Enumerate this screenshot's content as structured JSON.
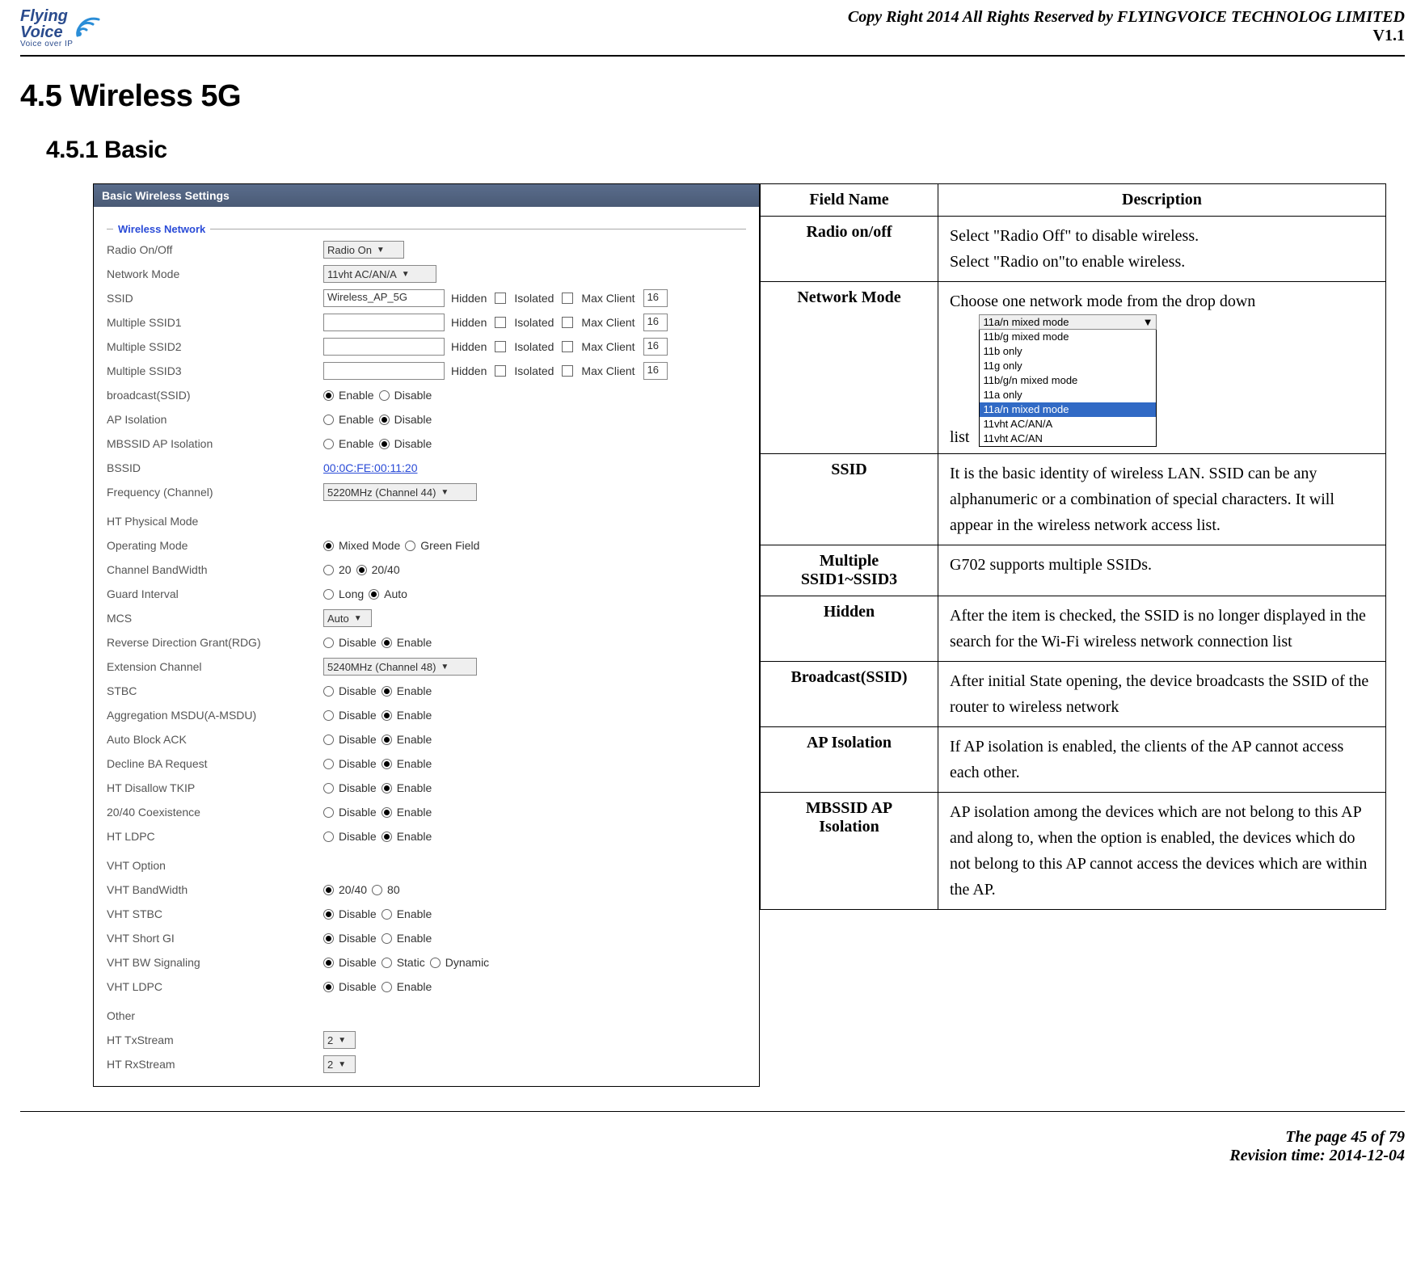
{
  "header": {
    "logo_line1": "Flying",
    "logo_line2": "Voice",
    "logo_sub": "Voice over IP",
    "copyright": "Copy Right 2014 All Rights Reserved by FLYINGVOICE TECHNOLOG LIMITED",
    "version": "V1.1"
  },
  "section": {
    "num_title": "4.5  Wireless 5G",
    "sub_num_title": "4.5.1 Basic"
  },
  "ui": {
    "title_bar": "Basic Wireless Settings",
    "fieldset": "Wireless Network",
    "rows": {
      "radio_onoff": {
        "label": "Radio On/Off",
        "value": "Radio On"
      },
      "network_mode": {
        "label": "Network Mode",
        "value": "11vht AC/AN/A"
      },
      "ssid": {
        "label": "SSID",
        "value": "Wireless_AP_5G",
        "hidden": "Hidden",
        "isolated": "Isolated",
        "max_client_label": "Max Client",
        "max_client_value": "16"
      },
      "mssid1": {
        "label": "Multiple SSID1",
        "hidden": "Hidden",
        "isolated": "Isolated",
        "max_client_label": "Max Client",
        "max_client_value": "16"
      },
      "mssid2": {
        "label": "Multiple SSID2",
        "hidden": "Hidden",
        "isolated": "Isolated",
        "max_client_label": "Max Client",
        "max_client_value": "16"
      },
      "mssid3": {
        "label": "Multiple SSID3",
        "hidden": "Hidden",
        "isolated": "Isolated",
        "max_client_label": "Max Client",
        "max_client_value": "16"
      },
      "broadcast": {
        "label": "broadcast(SSID)",
        "opt1": "Enable",
        "opt2": "Disable",
        "sel": "Enable"
      },
      "ap_iso": {
        "label": "AP Isolation",
        "opt1": "Enable",
        "opt2": "Disable",
        "sel": "Disable"
      },
      "mbssid_iso": {
        "label": "MBSSID AP Isolation",
        "opt1": "Enable",
        "opt2": "Disable",
        "sel": "Disable"
      },
      "bssid": {
        "label": "BSSID",
        "value": "00:0C:FE:00:11:20"
      },
      "freq": {
        "label": "Frequency (Channel)",
        "value": "5220MHz (Channel 44)"
      },
      "ht_header": "HT Physical Mode",
      "op_mode": {
        "label": "Operating Mode",
        "opt1": "Mixed Mode",
        "opt2": "Green Field",
        "sel": "Mixed Mode"
      },
      "ch_bw": {
        "label": "Channel BandWidth",
        "opt1": "20",
        "opt2": "20/40",
        "sel": "20/40"
      },
      "guard": {
        "label": "Guard Interval",
        "opt1": "Long",
        "opt2": "Auto",
        "sel": "Auto"
      },
      "mcs": {
        "label": "MCS",
        "value": "Auto"
      },
      "rdg": {
        "label": "Reverse Direction Grant(RDG)",
        "opt1": "Disable",
        "opt2": "Enable",
        "sel": "Enable"
      },
      "ext_ch": {
        "label": "Extension Channel",
        "value": "5240MHz (Channel 48)"
      },
      "stbc": {
        "label": "STBC",
        "opt1": "Disable",
        "opt2": "Enable",
        "sel": "Enable"
      },
      "amsdu": {
        "label": "Aggregation MSDU(A-MSDU)",
        "opt1": "Disable",
        "opt2": "Enable",
        "sel": "Enable"
      },
      "abck": {
        "label": "Auto Block ACK",
        "opt1": "Disable",
        "opt2": "Enable",
        "sel": "Enable"
      },
      "dba": {
        "label": "Decline BA Request",
        "opt1": "Disable",
        "opt2": "Enable",
        "sel": "Enable"
      },
      "tkip": {
        "label": "HT Disallow TKIP",
        "opt1": "Disable",
        "opt2": "Enable",
        "sel": "Enable"
      },
      "coex": {
        "label": "20/40 Coexistence",
        "opt1": "Disable",
        "opt2": "Enable",
        "sel": "Enable"
      },
      "ldpc": {
        "label": "HT LDPC",
        "opt1": "Disable",
        "opt2": "Enable",
        "sel": "Enable"
      },
      "vht_header": "VHT Option",
      "vht_bw": {
        "label": "VHT BandWidth",
        "opt1": "20/40",
        "opt2": "80",
        "sel": "20/40"
      },
      "vht_stbc": {
        "label": "VHT STBC",
        "opt1": "Disable",
        "opt2": "Enable",
        "sel": "Disable"
      },
      "vht_sgi": {
        "label": "VHT Short GI",
        "opt1": "Disable",
        "opt2": "Enable",
        "sel": "Disable"
      },
      "vht_bws": {
        "label": "VHT BW Signaling",
        "opt1": "Disable",
        "opt2": "Static",
        "opt3": "Dynamic",
        "sel": "Disable"
      },
      "vht_ldpc": {
        "label": "VHT LDPC",
        "opt1": "Disable",
        "opt2": "Enable",
        "sel": "Disable"
      },
      "other_header": "Other",
      "httx": {
        "label": "HT TxStream",
        "value": "2"
      },
      "htrx": {
        "label": "HT RxStream",
        "value": "2"
      }
    }
  },
  "desc_table": {
    "h1": "Field Name",
    "h2": "Description",
    "rows": [
      {
        "name": "Radio on/off",
        "desc_lines": [
          "Select \"Radio Off\" to disable wireless.",
          "Select \"Radio on\"to enable wireless."
        ]
      },
      {
        "name": "Network Mode",
        "desc_pre": "Choose one network mode from the drop down",
        "desc_post": "list",
        "dropdown": {
          "selected_top": "11a/n mixed mode",
          "options": [
            "11b/g mixed mode",
            "11b only",
            "11g only",
            "11b/g/n mixed mode",
            "11a only",
            "11a/n mixed mode",
            "11vht AC/AN/A",
            "11vht AC/AN"
          ],
          "highlight_index": 5
        }
      },
      {
        "name": "SSID",
        "desc": "It is the basic identity of wireless LAN. SSID can be any alphanumeric or a combination of special characters. It will appear in the wireless network access list."
      },
      {
        "name": "Multiple SSID1~SSID3",
        "desc": "G702 supports multiple SSIDs."
      },
      {
        "name": "Hidden",
        "desc": "After the item is checked, the SSID is no longer displayed in the search for the Wi-Fi wireless network connection list"
      },
      {
        "name": "Broadcast(SSID)",
        "desc": "After initial State opening, the device broadcasts the SSID of the router to wireless network"
      },
      {
        "name": "AP Isolation",
        "desc": "If AP isolation is enabled, the clients of the AP cannot access each other."
      },
      {
        "name": "MBSSID AP Isolation",
        "desc": "AP isolation among the devices which are not belong to this AP and along to, when the option is enabled, the devices which do not belong to this AP cannot access the devices which are within the AP."
      }
    ]
  },
  "footer": {
    "page": "The page 45 of 79",
    "rev": "Revision time: 2014-12-04"
  }
}
